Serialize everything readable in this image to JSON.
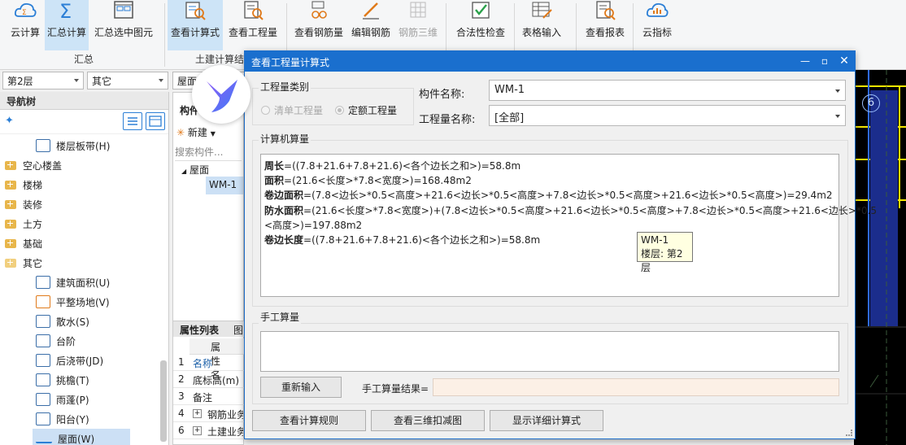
{
  "ribbon": {
    "buttons": [
      {
        "label": "云计算",
        "icon": "cloud-calc-icon"
      },
      {
        "label": "汇总计算",
        "icon": "sigma-icon"
      },
      {
        "label": "汇总选中图元",
        "icon": "summary-selected-icon"
      },
      {
        "label": "查看计算式",
        "icon": "view-formula-icon"
      },
      {
        "label": "查看工程量",
        "icon": "view-quantity-icon"
      },
      {
        "label": "查看钢筋量",
        "icon": "view-rebar-icon"
      },
      {
        "label": "编辑钢筋",
        "icon": "edit-rebar-icon"
      },
      {
        "label": "钢筋三维",
        "icon": "rebar-3d-icon"
      },
      {
        "label": "合法性检查",
        "icon": "validity-check-icon"
      },
      {
        "label": "表格输入",
        "icon": "table-input-icon"
      },
      {
        "label": "查看报表",
        "icon": "view-report-icon"
      },
      {
        "label": "云指标",
        "icon": "cloud-index-icon"
      }
    ],
    "groups": {
      "summary": "汇总",
      "civil": "土建计算结"
    }
  },
  "selectors": {
    "floor": "第2层",
    "category": "其它",
    "type": "屋面"
  },
  "nav": {
    "title": "导航树",
    "items": [
      {
        "label": "楼层板带(H)",
        "kind": "leaf"
      },
      {
        "label": "空心楼盖",
        "kind": "folder"
      },
      {
        "label": "楼梯",
        "kind": "folder"
      },
      {
        "label": "装修",
        "kind": "folder"
      },
      {
        "label": "土方",
        "kind": "folder"
      },
      {
        "label": "基础",
        "kind": "folder"
      },
      {
        "label": "其它",
        "kind": "folder-open"
      },
      {
        "label": "建筑面积(U)",
        "kind": "leaf"
      },
      {
        "label": "平整场地(V)",
        "kind": "leaf"
      },
      {
        "label": "散水(S)",
        "kind": "leaf"
      },
      {
        "label": "台阶",
        "kind": "leaf"
      },
      {
        "label": "后浇带(JD)",
        "kind": "leaf"
      },
      {
        "label": "挑檐(T)",
        "kind": "leaf"
      },
      {
        "label": "雨蓬(P)",
        "kind": "leaf"
      },
      {
        "label": "阳台(Y)",
        "kind": "leaf"
      },
      {
        "label": "屋面(W)",
        "kind": "leaf-selected"
      }
    ]
  },
  "mid": {
    "tab": "构件",
    "new_btn": "新建",
    "search_placeholder": "搜索构件...",
    "tree_root": "屋面",
    "tree_item": "WM-1",
    "props_tab": "属性列表",
    "props_tab2": "图",
    "props_header": "属性名",
    "props": [
      {
        "num": "1",
        "name": "名称"
      },
      {
        "num": "2",
        "name": "底标高(m)"
      },
      {
        "num": "3",
        "name": "备注"
      },
      {
        "num": "4",
        "name": "钢筋业务"
      },
      {
        "num": "6",
        "name": "土建业务"
      }
    ]
  },
  "dialog": {
    "title": "查看工程量计算式",
    "category_label": "工程量类别",
    "radio_list": "清单工程量",
    "radio_quota": "定额工程量",
    "component_label": "构件名称:",
    "component_value": "WM-1",
    "quantity_label": "工程量名称:",
    "quantity_value": "[全部]",
    "computed_label": "计算机算量",
    "lines": [
      {
        "name": "周长",
        "expr": "=((7.8+21.6+7.8+21.6)<各个边长之和>)=58.8m"
      },
      {
        "name": "面积",
        "expr": "=(21.6<长度>*7.8<宽度>)=168.48m2"
      },
      {
        "name": "卷边面积",
        "expr": "=(7.8<边长>*0.5<高度>+21.6<边长>*0.5<高度>+7.8<边长>*0.5<高度>+21.6<边长>*0.5<高度>)=29.4m2"
      },
      {
        "name": "防水面积",
        "expr": "=(21.6<长度>*7.8<宽度>)+(7.8<边长>*0.5<高度>+21.6<边长>*0.5<高度>+7.8<边长>*0.5<高度>+21.6<边长>*0.5"
      },
      {
        "name": "",
        "expr": "<高度>)=197.88m2"
      },
      {
        "name": "卷边长度",
        "expr": "=((7.8+21.6+7.8+21.6)<各个边长之和>)=58.8m"
      }
    ],
    "tooltip": {
      "line1": "WM-1",
      "line2": "楼层: 第2层"
    },
    "manual_label": "手工算量",
    "reinput_btn": "重新输入",
    "manual_result_label": "手工算量结果=",
    "btn_rules": "查看计算规则",
    "btn_3d": "查看三维扣减图",
    "btn_detail": "显示详细计算式"
  },
  "canvas": {
    "axis_label": "6"
  }
}
